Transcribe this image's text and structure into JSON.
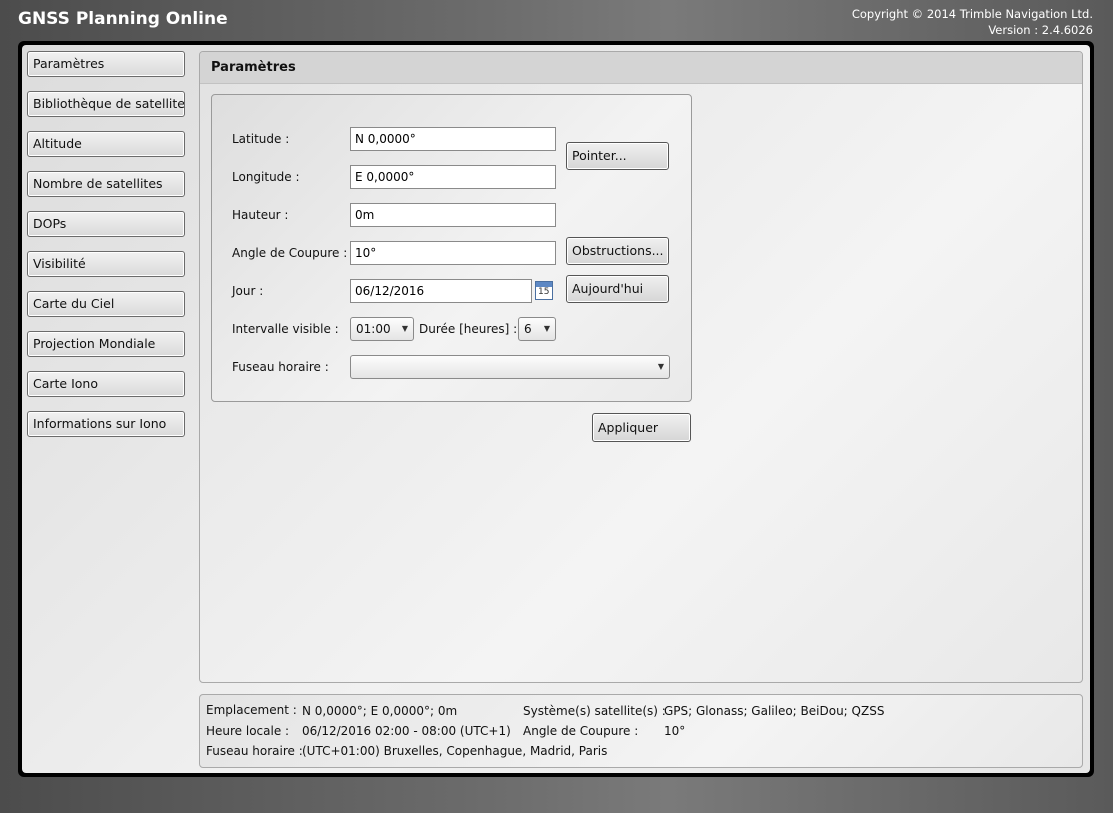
{
  "header": {
    "app_title": "GNSS Planning Online",
    "copyright": "Copyright © 2014 Trimble Navigation Ltd.",
    "version": "Version : 2.4.6026"
  },
  "sidebar": {
    "items": [
      {
        "label": "Paramètres"
      },
      {
        "label": "Bibliothèque de satellites"
      },
      {
        "label": "Altitude"
      },
      {
        "label": "Nombre de satellites"
      },
      {
        "label": "DOPs"
      },
      {
        "label": "Visibilité"
      },
      {
        "label": "Carte du Ciel"
      },
      {
        "label": "Projection Mondiale"
      },
      {
        "label": "Carte Iono"
      },
      {
        "label": "Informations sur Iono"
      }
    ]
  },
  "main": {
    "title": "Paramètres",
    "form": {
      "latitude_label": "Latitude :",
      "latitude_value": "N 0,0000°",
      "longitude_label": "Longitude :",
      "longitude_value": "E 0,0000°",
      "hauteur_label": "Hauteur :",
      "hauteur_value": "0m",
      "angle_label": "Angle de Coupure :",
      "angle_value": "10°",
      "jour_label": "Jour :",
      "jour_value": "06/12/2016",
      "calendar_day": "15",
      "intervalle_label": "Intervalle visible :",
      "intervalle_value": "01:00",
      "duree_label": "Durée [heures] :",
      "duree_value": "6",
      "fuseau_label": "Fuseau horaire :",
      "fuseau_value": ""
    },
    "buttons": {
      "pointer": "Pointer...",
      "obstructions": "Obstructions...",
      "aujourdhui": "Aujourd'hui",
      "appliquer": "Appliquer"
    }
  },
  "status": {
    "emplacement_label": "Emplacement :",
    "emplacement_value": "N 0,0000°; E 0,0000°; 0m",
    "systemes_label": "Système(s) satellite(s) :",
    "systemes_value": "GPS; Glonass; Galileo; BeiDou; QZSS",
    "heure_label": "Heure locale :",
    "heure_value": "06/12/2016 02:00 - 08:00 (UTC+1)",
    "angle_label": "Angle de Coupure :",
    "angle_value": "10°",
    "fuseau_label": "Fuseau horaire :",
    "fuseau_value": "(UTC+01:00) Bruxelles, Copenhague, Madrid, Paris"
  }
}
